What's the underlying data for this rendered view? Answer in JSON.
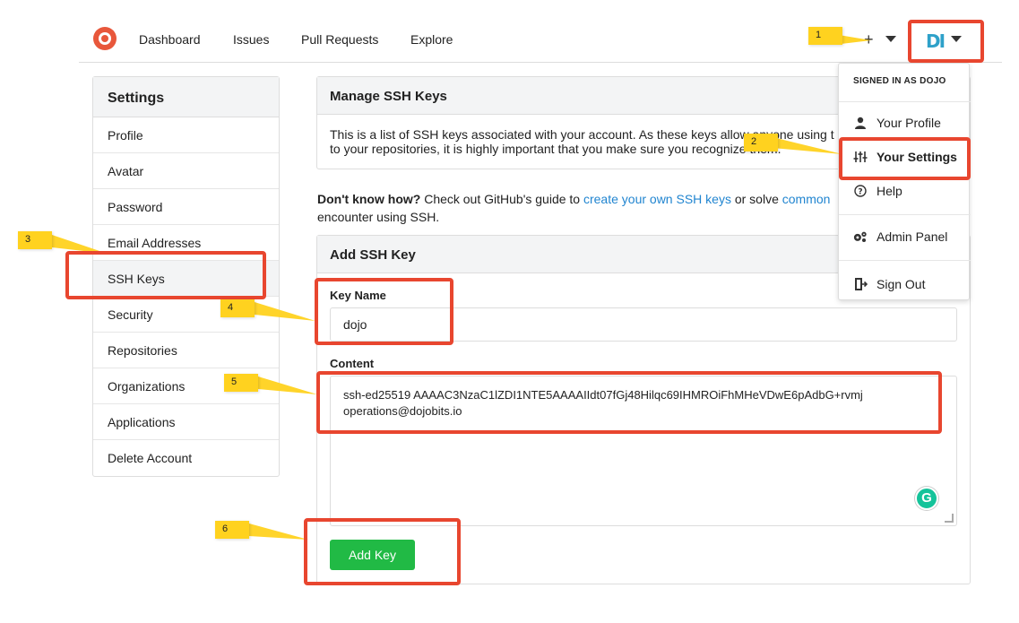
{
  "nav": {
    "links": [
      "Dashboard",
      "Issues",
      "Pull Requests",
      "Explore"
    ],
    "plus": "+",
    "avatar_initials": "DI"
  },
  "sidebar": {
    "title": "Settings",
    "items": [
      {
        "label": "Profile"
      },
      {
        "label": "Avatar"
      },
      {
        "label": "Password"
      },
      {
        "label": "Email Addresses"
      },
      {
        "label": "SSH Keys"
      },
      {
        "label": "Security"
      },
      {
        "label": "Repositories"
      },
      {
        "label": "Organizations"
      },
      {
        "label": "Applications"
      },
      {
        "label": "Delete Account"
      }
    ]
  },
  "manage": {
    "title": "Manage SSH Keys",
    "desc_line1": "This is a list of SSH keys associated with your account. As these keys allow anyone using t",
    "desc_line2": "to your repositories, it is highly important that you make sure you recognize them."
  },
  "help": {
    "lead": "Don't know how?",
    "text1": " Check out GitHub's guide to ",
    "link1": "create your own SSH keys",
    "text2": " or solve ",
    "link2": "common",
    "text3": "encounter using SSH."
  },
  "add_key": {
    "title": "Add SSH Key",
    "key_name_label": "Key Name",
    "key_name_value": "dojo",
    "content_label": "Content",
    "content_line1": "ssh-ed25519 AAAAC3NzaC1lZDI1NTE5AAAAIIdt07fGj48Hilqc69IHMROiFhMHeVDwE6pAdbG+rvmj",
    "content_line2": "operations@dojobits.io",
    "button_label": "Add Key",
    "grammarly": "G"
  },
  "dropdown": {
    "header": "SIGNED IN AS DOJO",
    "items": [
      {
        "label": "Your Profile",
        "icon": "person-icon"
      },
      {
        "label": "Your Settings",
        "icon": "sliders-icon"
      },
      {
        "label": "Help",
        "icon": "question-icon"
      },
      {
        "label": "Admin Panel",
        "icon": "gears-icon"
      },
      {
        "label": "Sign Out",
        "icon": "sign-out-icon"
      }
    ]
  },
  "annotations": [
    "1",
    "2",
    "3",
    "4",
    "5",
    "6"
  ],
  "colors": {
    "accent_red": "#e8462f",
    "badge_yellow": "#ffd21f",
    "button_green": "#21ba45",
    "link_blue": "#2185d0"
  }
}
